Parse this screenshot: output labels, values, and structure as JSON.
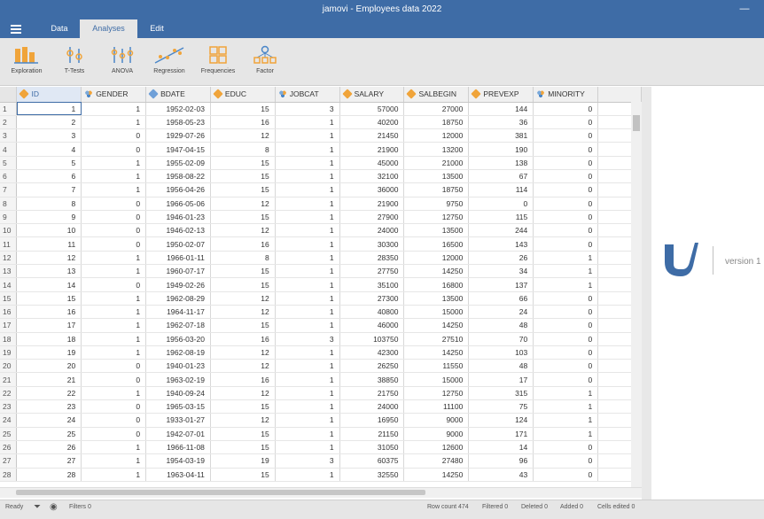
{
  "window": {
    "title": "jamovi - Employees data 2022",
    "minimize": "—"
  },
  "tabs": [
    {
      "label": "Data"
    },
    {
      "label": "Analyses"
    },
    {
      "label": "Edit"
    }
  ],
  "ribbon": [
    {
      "label": "Exploration",
      "icon": "exploration-icon"
    },
    {
      "label": "T-Tests",
      "icon": "t-tests-icon"
    },
    {
      "label": "ANOVA",
      "icon": "anova-icon"
    },
    {
      "label": "Regression",
      "icon": "regression-icon"
    },
    {
      "label": "Frequencies",
      "icon": "frequencies-icon"
    },
    {
      "label": "Factor",
      "icon": "factor-icon"
    }
  ],
  "colors": {
    "accent": "#3e6ca6",
    "ribbon_orange": "#f0a43a",
    "ribbon_blue": "#4a86c8"
  },
  "columns": [
    {
      "name": "ID",
      "type": "ruler"
    },
    {
      "name": "GENDER",
      "type": "nominal"
    },
    {
      "name": "BDATE",
      "type": "ordinal"
    },
    {
      "name": "EDUC",
      "type": "ruler"
    },
    {
      "name": "JOBCAT",
      "type": "nominal"
    },
    {
      "name": "SALARY",
      "type": "ruler"
    },
    {
      "name": "SALBEGIN",
      "type": "ruler"
    },
    {
      "name": "PREVEXP",
      "type": "ruler"
    },
    {
      "name": "MINORITY",
      "type": "nominal"
    }
  ],
  "rows": [
    [
      "1",
      "1",
      "1",
      "1952-02-03",
      "15",
      "3",
      "57000",
      "27000",
      "144",
      "0"
    ],
    [
      "2",
      "2",
      "1",
      "1958-05-23",
      "16",
      "1",
      "40200",
      "18750",
      "36",
      "0"
    ],
    [
      "3",
      "3",
      "0",
      "1929-07-26",
      "12",
      "1",
      "21450",
      "12000",
      "381",
      "0"
    ],
    [
      "4",
      "4",
      "0",
      "1947-04-15",
      "8",
      "1",
      "21900",
      "13200",
      "190",
      "0"
    ],
    [
      "5",
      "5",
      "1",
      "1955-02-09",
      "15",
      "1",
      "45000",
      "21000",
      "138",
      "0"
    ],
    [
      "6",
      "6",
      "1",
      "1958-08-22",
      "15",
      "1",
      "32100",
      "13500",
      "67",
      "0"
    ],
    [
      "7",
      "7",
      "1",
      "1956-04-26",
      "15",
      "1",
      "36000",
      "18750",
      "114",
      "0"
    ],
    [
      "8",
      "8",
      "0",
      "1966-05-06",
      "12",
      "1",
      "21900",
      "9750",
      "0",
      "0"
    ],
    [
      "9",
      "9",
      "0",
      "1946-01-23",
      "15",
      "1",
      "27900",
      "12750",
      "115",
      "0"
    ],
    [
      "10",
      "10",
      "0",
      "1946-02-13",
      "12",
      "1",
      "24000",
      "13500",
      "244",
      "0"
    ],
    [
      "11",
      "11",
      "0",
      "1950-02-07",
      "16",
      "1",
      "30300",
      "16500",
      "143",
      "0"
    ],
    [
      "12",
      "12",
      "1",
      "1966-01-11",
      "8",
      "1",
      "28350",
      "12000",
      "26",
      "1"
    ],
    [
      "13",
      "13",
      "1",
      "1960-07-17",
      "15",
      "1",
      "27750",
      "14250",
      "34",
      "1"
    ],
    [
      "14",
      "14",
      "0",
      "1949-02-26",
      "15",
      "1",
      "35100",
      "16800",
      "137",
      "1"
    ],
    [
      "15",
      "15",
      "1",
      "1962-08-29",
      "12",
      "1",
      "27300",
      "13500",
      "66",
      "0"
    ],
    [
      "16",
      "16",
      "1",
      "1964-11-17",
      "12",
      "1",
      "40800",
      "15000",
      "24",
      "0"
    ],
    [
      "17",
      "17",
      "1",
      "1962-07-18",
      "15",
      "1",
      "46000",
      "14250",
      "48",
      "0"
    ],
    [
      "18",
      "18",
      "1",
      "1956-03-20",
      "16",
      "3",
      "103750",
      "27510",
      "70",
      "0"
    ],
    [
      "19",
      "19",
      "1",
      "1962-08-19",
      "12",
      "1",
      "42300",
      "14250",
      "103",
      "0"
    ],
    [
      "20",
      "20",
      "0",
      "1940-01-23",
      "12",
      "1",
      "26250",
      "11550",
      "48",
      "0"
    ],
    [
      "21",
      "21",
      "0",
      "1963-02-19",
      "16",
      "1",
      "38850",
      "15000",
      "17",
      "0"
    ],
    [
      "22",
      "22",
      "1",
      "1940-09-24",
      "12",
      "1",
      "21750",
      "12750",
      "315",
      "1"
    ],
    [
      "23",
      "23",
      "0",
      "1965-03-15",
      "15",
      "1",
      "24000",
      "11100",
      "75",
      "1"
    ],
    [
      "24",
      "24",
      "0",
      "1933-01-27",
      "12",
      "1",
      "16950",
      "9000",
      "124",
      "1"
    ],
    [
      "25",
      "25",
      "0",
      "1942-07-01",
      "15",
      "1",
      "21150",
      "9000",
      "171",
      "1"
    ],
    [
      "26",
      "26",
      "1",
      "1966-11-08",
      "15",
      "1",
      "31050",
      "12600",
      "14",
      "0"
    ],
    [
      "27",
      "27",
      "1",
      "1954-03-19",
      "19",
      "3",
      "60375",
      "27480",
      "96",
      "0"
    ],
    [
      "28",
      "28",
      "1",
      "1963-04-11",
      "15",
      "1",
      "32550",
      "14250",
      "43",
      "0"
    ]
  ],
  "results": {
    "version": "version 1"
  },
  "status": {
    "ready": "Ready",
    "filters": "Filters 0",
    "row_count": "Row count 474",
    "filtered": "Filtered 0",
    "deleted": "Deleted 0",
    "added": "Added 0",
    "cells_edited": "Cells edited 0"
  }
}
